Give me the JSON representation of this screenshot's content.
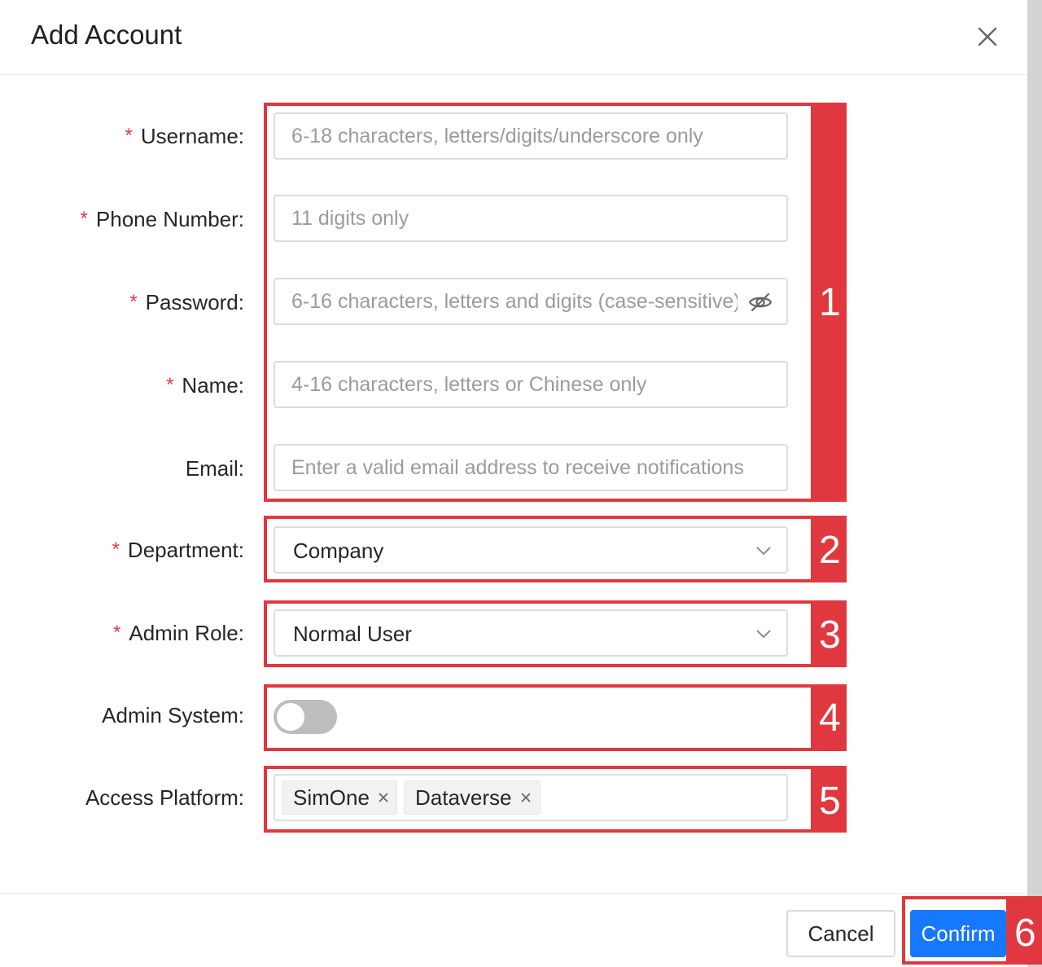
{
  "dialog": {
    "title": "Add Account",
    "close_icon": "close-icon"
  },
  "form": {
    "required_mark": "*",
    "username": {
      "label": "Username:",
      "placeholder": "6-18 characters, letters/digits/underscore only",
      "required": true
    },
    "phone": {
      "label": "Phone Number:",
      "placeholder": "11 digits only",
      "required": true
    },
    "password": {
      "label": "Password:",
      "placeholder": "6-16 characters, letters and digits (case-sensitive)",
      "required": true,
      "toggle_icon": "eye-off-icon"
    },
    "name": {
      "label": "Name:",
      "placeholder": "4-16 characters, letters or Chinese only",
      "required": true
    },
    "email": {
      "label": "Email:",
      "placeholder": "Enter a valid email address to receive notifications",
      "required": false
    },
    "department": {
      "label": "Department:",
      "value": "Company",
      "required": true,
      "icon": "chevron-down-icon"
    },
    "admin_role": {
      "label": "Admin Role:",
      "value": "Normal User",
      "required": true,
      "icon": "chevron-down-icon"
    },
    "admin_system": {
      "label": "Admin System:",
      "enabled": false
    },
    "access_platform": {
      "label": "Access Platform:",
      "tags": [
        "SimOne",
        "Dataverse"
      ]
    }
  },
  "footer": {
    "cancel_label": "Cancel",
    "confirm_label": "Confirm"
  },
  "annotations": [
    "1",
    "2",
    "3",
    "4",
    "5",
    "6"
  ],
  "colors": {
    "annotation": "#e0383e",
    "primary": "#1677ff",
    "required": "#e23a3f",
    "placeholder": "#9b9b9b",
    "toggle_off": "#bdbdbd"
  }
}
